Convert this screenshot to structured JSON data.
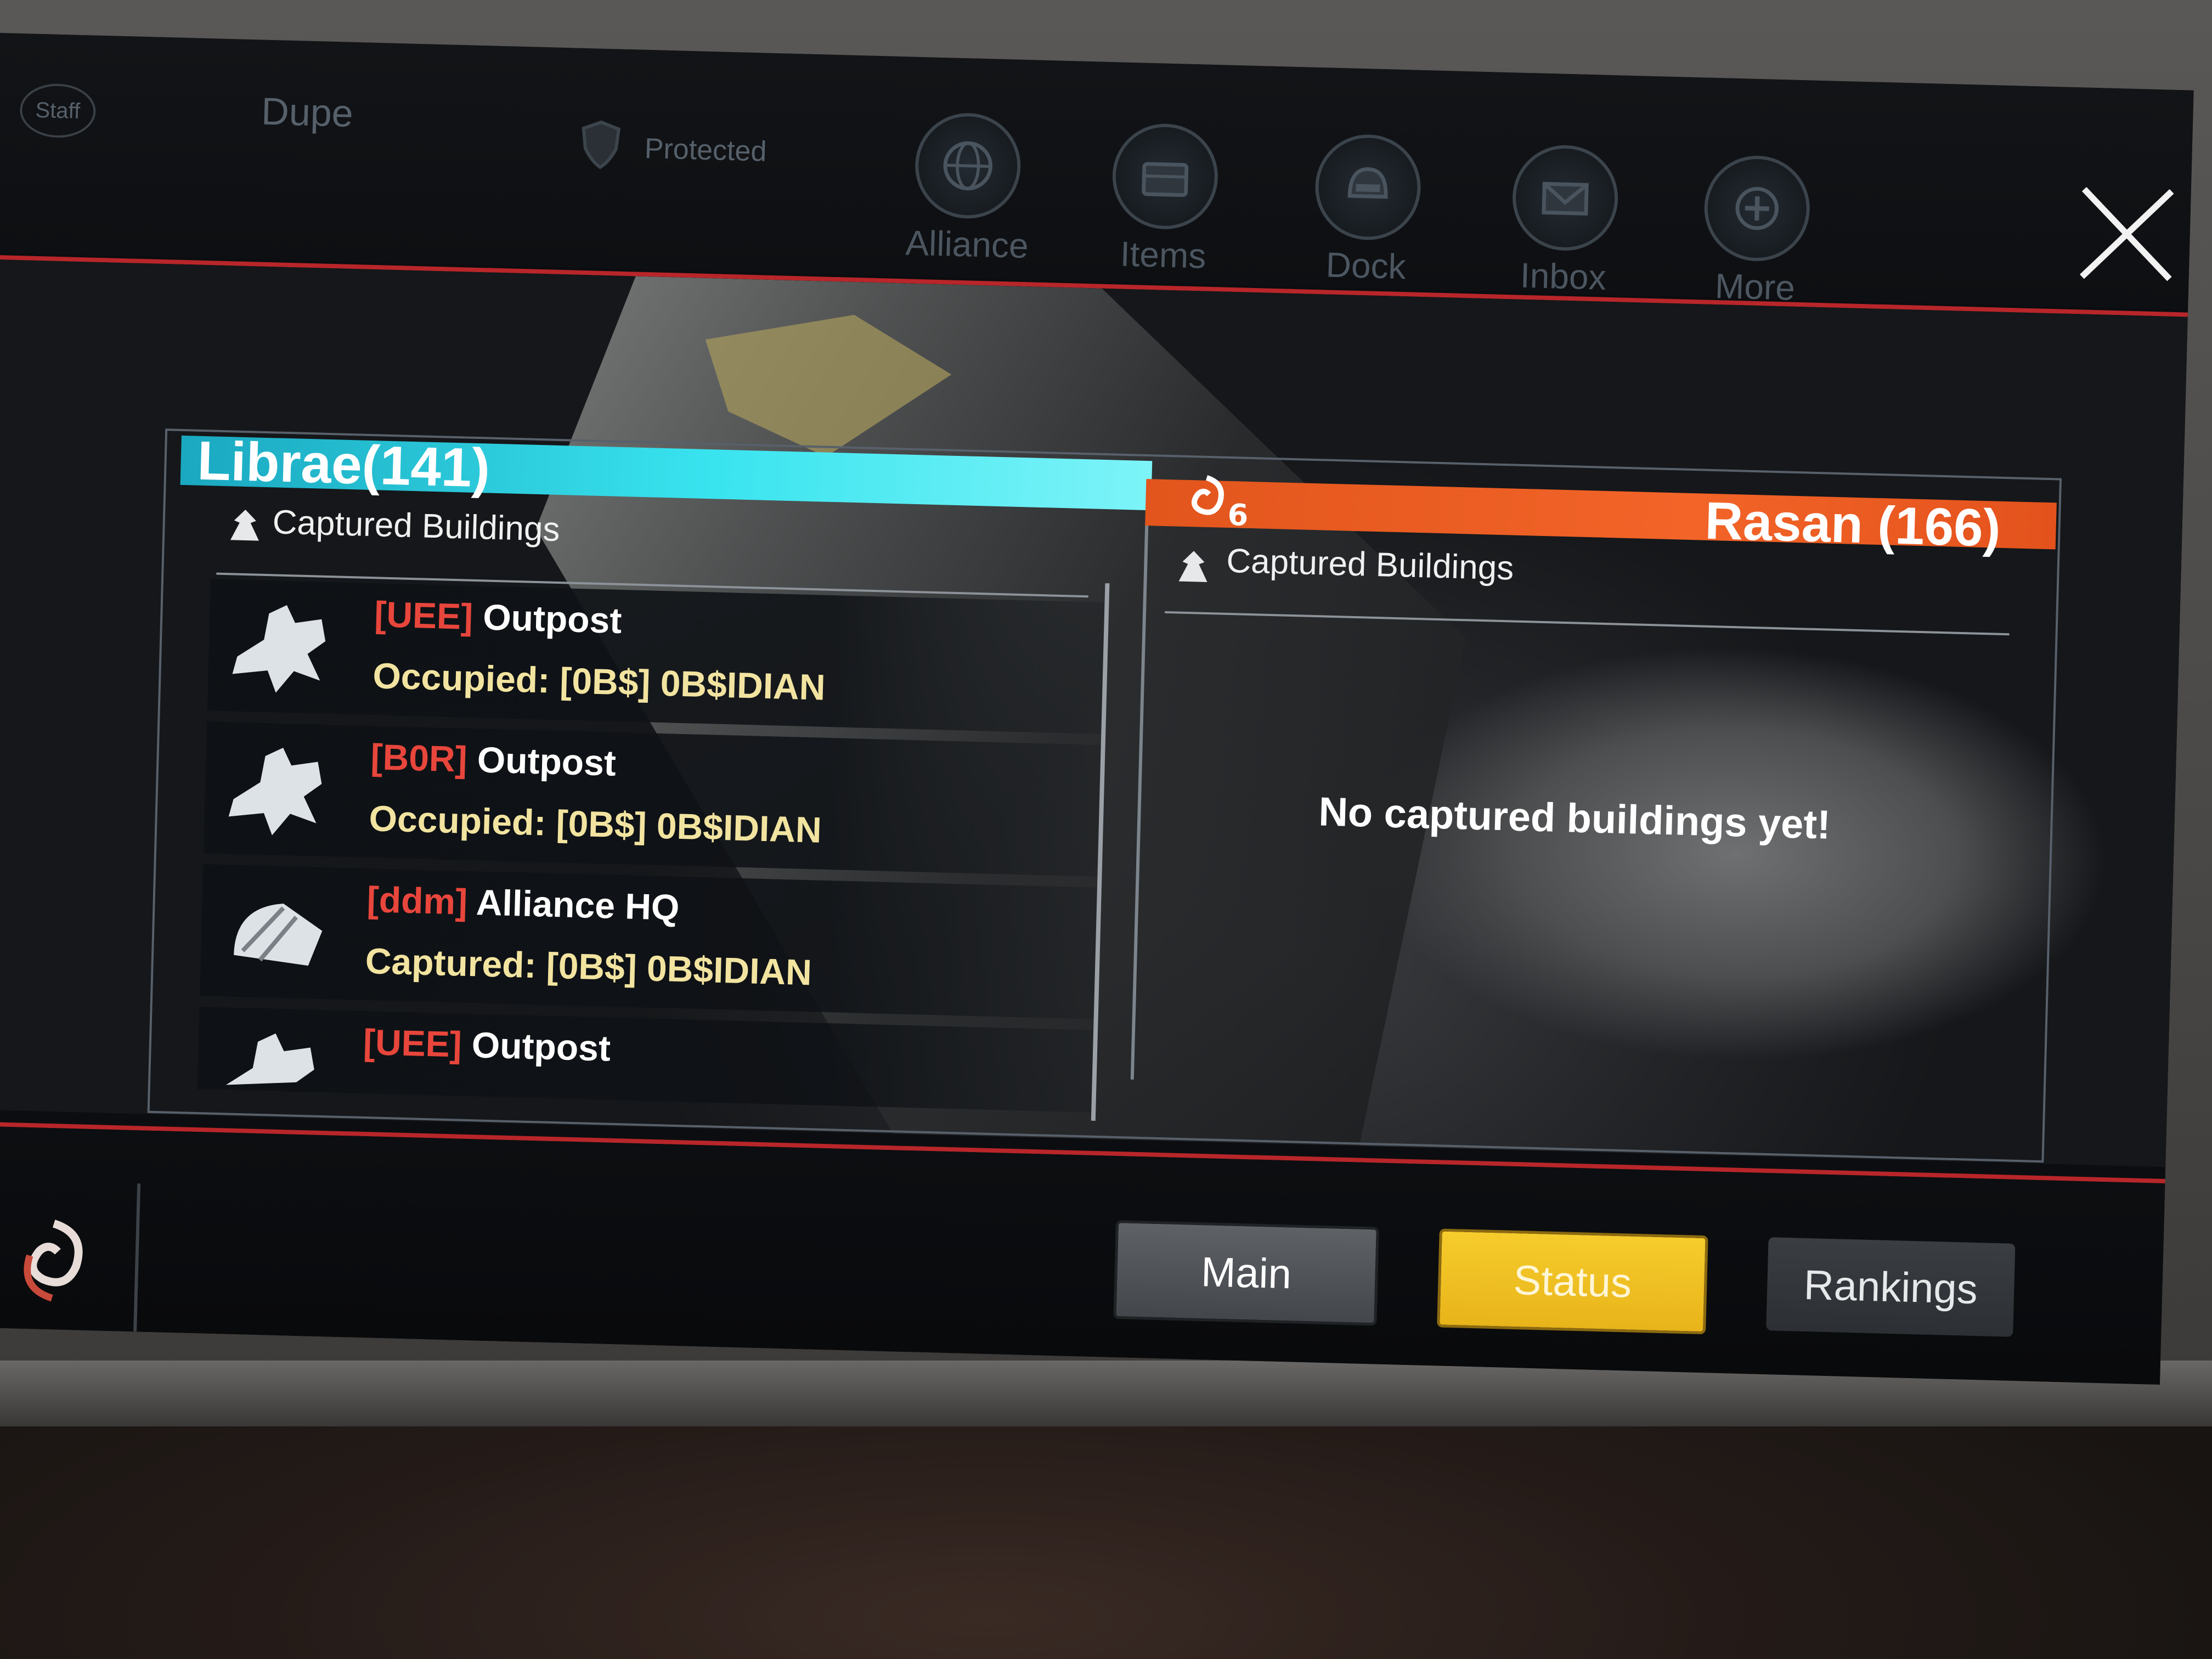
{
  "top_bar": {
    "staff_label": "Staff",
    "player_name": "Dupe",
    "protected_label": "Protected",
    "nav": [
      {
        "label": "Alliance",
        "icon": "globe-icon"
      },
      {
        "label": "Items",
        "icon": "chest-icon"
      },
      {
        "label": "Dock",
        "icon": "helmet-icon"
      },
      {
        "label": "Inbox",
        "icon": "mail-icon"
      },
      {
        "label": "More",
        "icon": "plus-icon"
      }
    ]
  },
  "left_panel": {
    "title": "Librae(141)",
    "subtitle": "Captured Buildings",
    "buildings": [
      {
        "tag": "[UEE]",
        "name": "Outpost",
        "status": "Occupied: [0B$] 0B$IDIAN"
      },
      {
        "tag": "[B0R]",
        "name": "Outpost",
        "status": "Occupied: [0B$] 0B$IDIAN"
      },
      {
        "tag": "[ddm]",
        "name": "Alliance HQ",
        "status": "Captured: [0B$] 0B$IDIAN"
      },
      {
        "tag": "[UEE]",
        "name": "Outpost",
        "status": ""
      }
    ]
  },
  "right_panel": {
    "title": "Rasan (166)",
    "badge_number": "6",
    "subtitle": "Captured Buildings",
    "empty_message": "No captured buildings yet!"
  },
  "bottom_tabs": {
    "main": "Main",
    "status": "Status",
    "rankings": "Rankings",
    "active": "Status"
  },
  "colors": {
    "accent_red": "#b8262a",
    "left_header": "#39e4ef",
    "right_header": "#f26428",
    "active_tab": "#f6cc2c",
    "tag_red": "#e8463c",
    "status_yellow": "#f2e4a0"
  }
}
